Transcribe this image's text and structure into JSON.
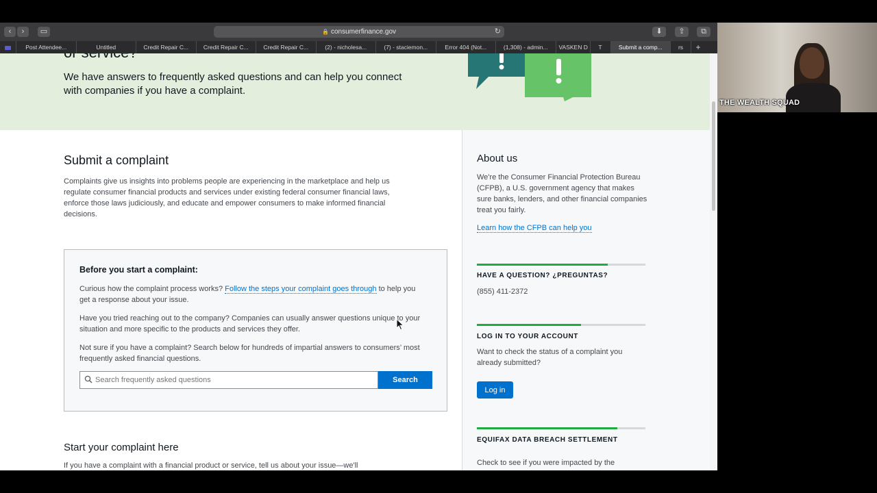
{
  "browser": {
    "url": "consumerfinance.gov",
    "tabs": [
      "Post Attendee...",
      "Untitled",
      "Credit Repair C...",
      "Credit Repair C...",
      "Credit Repair C...",
      "(2) - nicholesa...",
      "(7) - staciemon...",
      "Error 404 (Not...",
      "(1,308) - admin...",
      "VASKEN D",
      "T",
      "Submit a comp...",
      "rs"
    ]
  },
  "hero": {
    "title_tail": "or service?",
    "text": "We have answers to frequently asked questions and can help you connect with companies if you have a complaint."
  },
  "submit": {
    "title": "Submit a complaint",
    "description": "Complaints give us insights into problems people are experiencing in the marketplace and help us regulate consumer financial products and services under existing federal consumer financial laws, enforce those laws judiciously, and educate and empower consumers to make informed financial decisions."
  },
  "before": {
    "title": "Before you start a complaint:",
    "p1_pre": "Curious how the complaint process works?",
    "p1_link": "Follow the steps your complaint goes through",
    "p1_post": "to help you get a response about your issue.",
    "p2": "Have you tried reaching out to the company? Companies can usually answer questions unique to your situation and more specific to the products and services they offer.",
    "p3": "Not sure if you have a complaint? Search below for hundreds of impartial answers to consumers’ most frequently asked financial questions.",
    "search_placeholder": "Search frequently asked questions",
    "search_button": "Search"
  },
  "start": {
    "title": "Start your complaint here",
    "description": "If you have a complaint with a financial product or service, tell us about your issue—we'll"
  },
  "aside": {
    "about_title": "About us",
    "about_desc": "We're the Consumer Financial Protection Bureau (CFPB), a U.S. government agency that makes sure banks, lenders, and other financial companies treat you fairly.",
    "about_link": "Learn how the CFPB can help you",
    "question_head": "HAVE A QUESTION? ¿PREGUNTAS?",
    "phone": "(855) 411-2372",
    "login_head": "LOG IN TO YOUR ACCOUNT",
    "login_text": "Want to check the status of a complaint you already submitted?",
    "login_button": "Log in",
    "equifax_head": "EQUIFAX DATA BREACH SETTLEMENT",
    "equifax_text": "Check to see if you were impacted by the"
  },
  "video": {
    "label": "THE WEALTH SQUAD"
  },
  "colors": {
    "accent_blue": "#0072ce",
    "hero_green_bg": "#e3efdc",
    "rule_green": "#20aa3f"
  }
}
